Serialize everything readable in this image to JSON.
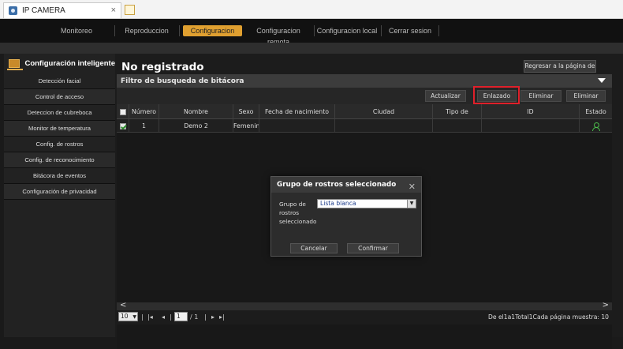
{
  "browser": {
    "tab_title": "IP CAMERA",
    "tab_close": "×"
  },
  "topnav": {
    "items": [
      {
        "label": "Monitoreo"
      },
      {
        "label": "Reproduccion"
      },
      {
        "label": "Configuracion",
        "active": true
      },
      {
        "label": "Configuracion remota"
      },
      {
        "label": "Configuracion local"
      },
      {
        "label": "Cerrar sesion"
      }
    ]
  },
  "sidebar": {
    "title": "Configuración inteligente",
    "items": [
      {
        "label": "Detección facial"
      },
      {
        "label": "Control de acceso"
      },
      {
        "label": "Deteccion de cubreboca"
      },
      {
        "label": "Monitor de temperatura"
      },
      {
        "label": "Config. de rostros"
      },
      {
        "label": "Config. de reconocimiento"
      },
      {
        "label": "Bitácora de eventos"
      },
      {
        "label": "Configuración de privacidad"
      }
    ]
  },
  "main": {
    "title": "No registrado",
    "return_label": "Regresar a la página de",
    "filter_title": "Filtro de busqueda de bitácora",
    "actions": {
      "refresh": "Actualizar",
      "link": "Enlazado",
      "delete1": "Eliminar",
      "delete2": "Eliminar"
    },
    "table": {
      "headers": [
        "Número",
        "Nombre",
        "Sexo",
        "Fecha de nacimiento",
        "Ciudad",
        "Tipo de",
        "ID",
        "Estado"
      ],
      "rows": [
        {
          "numero": "1",
          "nombre": "Demo 2",
          "sexo": "Femenin",
          "fecha": "",
          "ciudad": "",
          "tipo": "",
          "id": "",
          "estado_icon": "person-icon",
          "checked": true
        }
      ]
    },
    "scroll": {
      "left": "<",
      "right": ">"
    },
    "pager": {
      "page_size": "10",
      "first": "|◂",
      "prev": "◂",
      "sep1": "|",
      "page": "1",
      "total": "/ 1",
      "sep2": "|",
      "next": "▸",
      "last": "▸|",
      "info": "De el1a1Total1Cada página muestra: 10"
    }
  },
  "dialog": {
    "title": "Grupo de rostros seleccionado",
    "close": "✕",
    "label": "Grupo de rostros seleccionado",
    "selected": "Lista blanca",
    "cancel": "Cancelar",
    "confirm": "Confirmar"
  },
  "colors": {
    "accent": "#e0a030",
    "highlight": "#e0202a",
    "status_ok": "#4cc04c"
  }
}
